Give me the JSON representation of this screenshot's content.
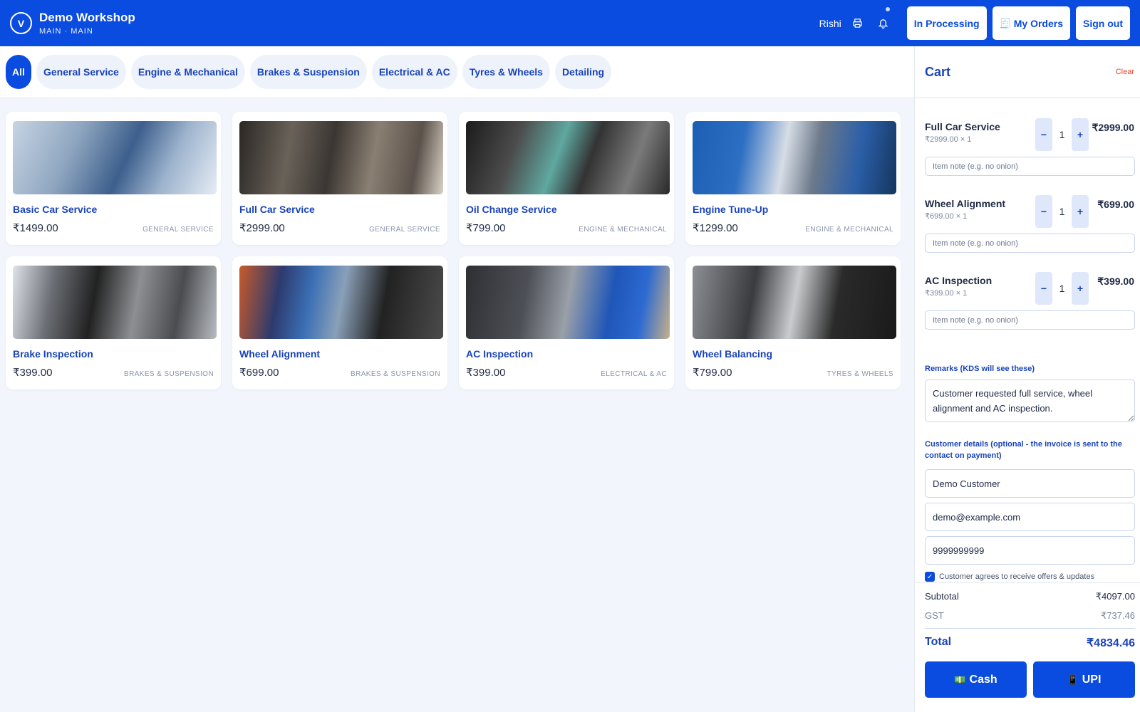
{
  "header": {
    "logo_letter": "V",
    "title": "Demo Workshop",
    "subtitle": "MAIN · MAIN",
    "user": "Rishi",
    "in_processing": "In Processing",
    "my_orders": "My Orders",
    "my_orders_icon": "🧾",
    "sign_out": "Sign out",
    "icons": [
      "printer-icon",
      "bell-icon"
    ]
  },
  "categories": [
    {
      "label": "All",
      "active": true
    },
    {
      "label": "General Service"
    },
    {
      "label": "Engine & Mechanical"
    },
    {
      "label": "Brakes & Suspension"
    },
    {
      "label": "Electrical & AC"
    },
    {
      "label": "Tyres & Wheels"
    },
    {
      "label": "Detailing"
    }
  ],
  "products": [
    {
      "name": "Basic Car Service",
      "price": "₹1499.00",
      "category": "GENERAL SERVICE"
    },
    {
      "name": "Full Car Service",
      "price": "₹2999.00",
      "category": "GENERAL SERVICE"
    },
    {
      "name": "Oil Change Service",
      "price": "₹799.00",
      "category": "ENGINE & MECHANICAL"
    },
    {
      "name": "Engine Tune-Up",
      "price": "₹1299.00",
      "category": "ENGINE & MECHANICAL"
    },
    {
      "name": "Brake Inspection",
      "price": "₹399.00",
      "category": "BRAKES & SUSPENSION"
    },
    {
      "name": "Wheel Alignment",
      "price": "₹699.00",
      "category": "BRAKES & SUSPENSION"
    },
    {
      "name": "AC Inspection",
      "price": "₹399.00",
      "category": "ELECTRICAL & AC"
    },
    {
      "name": "Wheel Balancing",
      "price": "₹799.00",
      "category": "TYRES & WHEELS"
    }
  ],
  "cart": {
    "title": "Cart",
    "clear": "Clear",
    "minus": "−",
    "plus": "+",
    "note_placeholder": "Item note (e.g. no onion)",
    "items": [
      {
        "name": "Full Car Service",
        "unit": "₹2999.00 × 1",
        "qty": "1",
        "total": "₹2999.00"
      },
      {
        "name": "Wheel Alignment",
        "unit": "₹699.00 × 1",
        "qty": "1",
        "total": "₹699.00"
      },
      {
        "name": "AC Inspection",
        "unit": "₹399.00 × 1",
        "qty": "1",
        "total": "₹399.00"
      }
    ],
    "remarks_label": "Remarks (KDS will see these)",
    "remarks_value": "Customer requested full service, wheel alignment and AC inspection.",
    "customer_label": "Customer details (optional - the invoice is sent to the contact on payment)",
    "customer_name": "Demo Customer",
    "customer_email": "demo@example.com",
    "customer_phone": "9999999999",
    "agree_checked": true,
    "agree_text": "Customer agrees to receive offers & updates",
    "subtotal_label": "Subtotal",
    "subtotal": "₹4097.00",
    "gst_label": "GST",
    "gst": "₹737.46",
    "total_label": "Total",
    "total": "₹4834.46",
    "cash_icon": "💵",
    "cash": "Cash",
    "upi_icon": "📱",
    "upi": "UPI"
  },
  "colors": {
    "brand": "#0a4be0",
    "accent_text": "#1a44b8",
    "danger": "#e0452b"
  }
}
